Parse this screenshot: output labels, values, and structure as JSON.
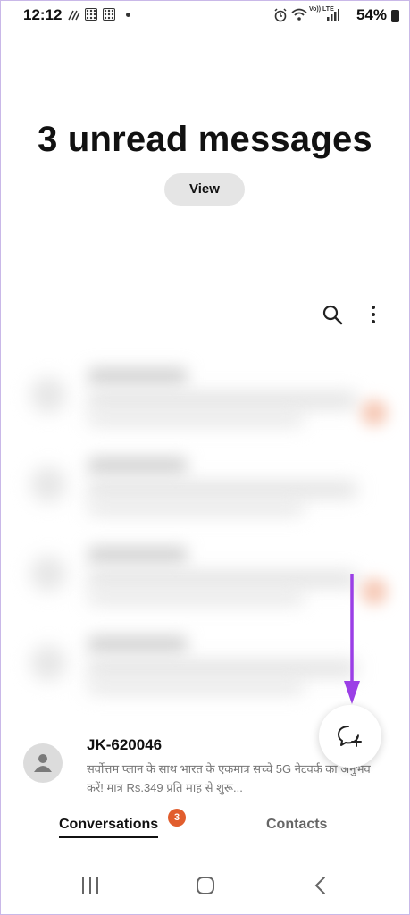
{
  "status_bar": {
    "time": "12:12",
    "battery": "54%",
    "network": "Vo)) LTE"
  },
  "header": {
    "title": "3 unread messages",
    "view_label": "View"
  },
  "toolbar": {
    "search_icon": "search-icon",
    "more_icon": "more-options-icon"
  },
  "conversation": {
    "sender": "JK-620046",
    "preview": "सर्वोत्तम प्लान के साथ भारत के एकमात्र सच्चे 5G नेटवर्क का अनुभव करें! मात्र Rs.349 प्रति माह से शुरू..."
  },
  "fab": {
    "icon": "new-message-icon"
  },
  "tabs": {
    "conversations": "Conversations",
    "conversations_badge": "3",
    "contacts": "Contacts"
  },
  "colors": {
    "badge": "#e15d2d",
    "arrow": "#9b3fe6"
  }
}
